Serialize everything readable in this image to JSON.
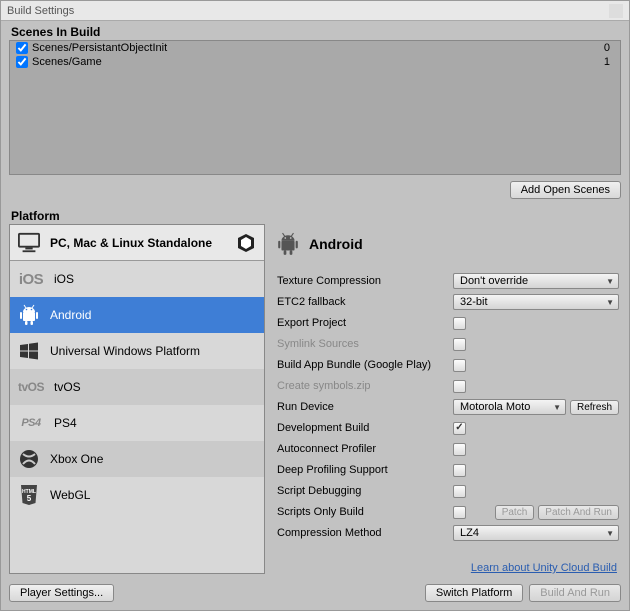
{
  "window": {
    "title": "Build Settings"
  },
  "scenes": {
    "label": "Scenes In Build",
    "items": [
      {
        "checked": true,
        "path": "Scenes/PersistantObjectInit",
        "index": "0"
      },
      {
        "checked": true,
        "path": "Scenes/Game",
        "index": "1"
      }
    ],
    "add_button": "Add Open Scenes"
  },
  "platforms": {
    "label": "Platform",
    "items": [
      {
        "id": "standalone",
        "label": "PC, Mac & Linux Standalone",
        "current": true
      },
      {
        "id": "ios",
        "label": "iOS",
        "logo": "iOS"
      },
      {
        "id": "android",
        "label": "Android",
        "selected": true
      },
      {
        "id": "uwp",
        "label": "Universal Windows Platform"
      },
      {
        "id": "tvos",
        "label": "tvOS",
        "logo": "tvOS"
      },
      {
        "id": "ps4",
        "label": "PS4",
        "logo": "PS4"
      },
      {
        "id": "xboxone",
        "label": "Xbox One"
      },
      {
        "id": "webgl",
        "label": "WebGL",
        "logo": "HTML\n5"
      }
    ]
  },
  "details": {
    "header": "Android",
    "rows": {
      "texture_compression": {
        "label": "Texture Compression",
        "value": "Don't override"
      },
      "etc2_fallback": {
        "label": "ETC2 fallback",
        "value": "32-bit"
      },
      "export_project": {
        "label": "Export Project",
        "checked": false
      },
      "symlink_sources": {
        "label": "Symlink Sources",
        "checked": false,
        "disabled": true
      },
      "build_app_bundle": {
        "label": "Build App Bundle (Google Play)",
        "checked": false
      },
      "create_symbols": {
        "label": "Create symbols.zip",
        "checked": false,
        "disabled": true
      },
      "run_device": {
        "label": "Run Device",
        "value": "Motorola Moto",
        "refresh": "Refresh"
      },
      "development_build": {
        "label": "Development Build",
        "checked": true
      },
      "autoconnect_profiler": {
        "label": "Autoconnect Profiler",
        "checked": false
      },
      "deep_profiling": {
        "label": "Deep Profiling Support",
        "checked": false
      },
      "script_debugging": {
        "label": "Script Debugging",
        "checked": false
      },
      "scripts_only_build": {
        "label": "Scripts Only Build",
        "checked": false,
        "patch": "Patch",
        "patch_run": "Patch And Run"
      },
      "compression_method": {
        "label": "Compression Method",
        "value": "LZ4"
      }
    },
    "link": "Learn about Unity Cloud Build"
  },
  "footer": {
    "player_settings": "Player Settings...",
    "switch_platform": "Switch Platform",
    "build_and_run": "Build And Run"
  }
}
